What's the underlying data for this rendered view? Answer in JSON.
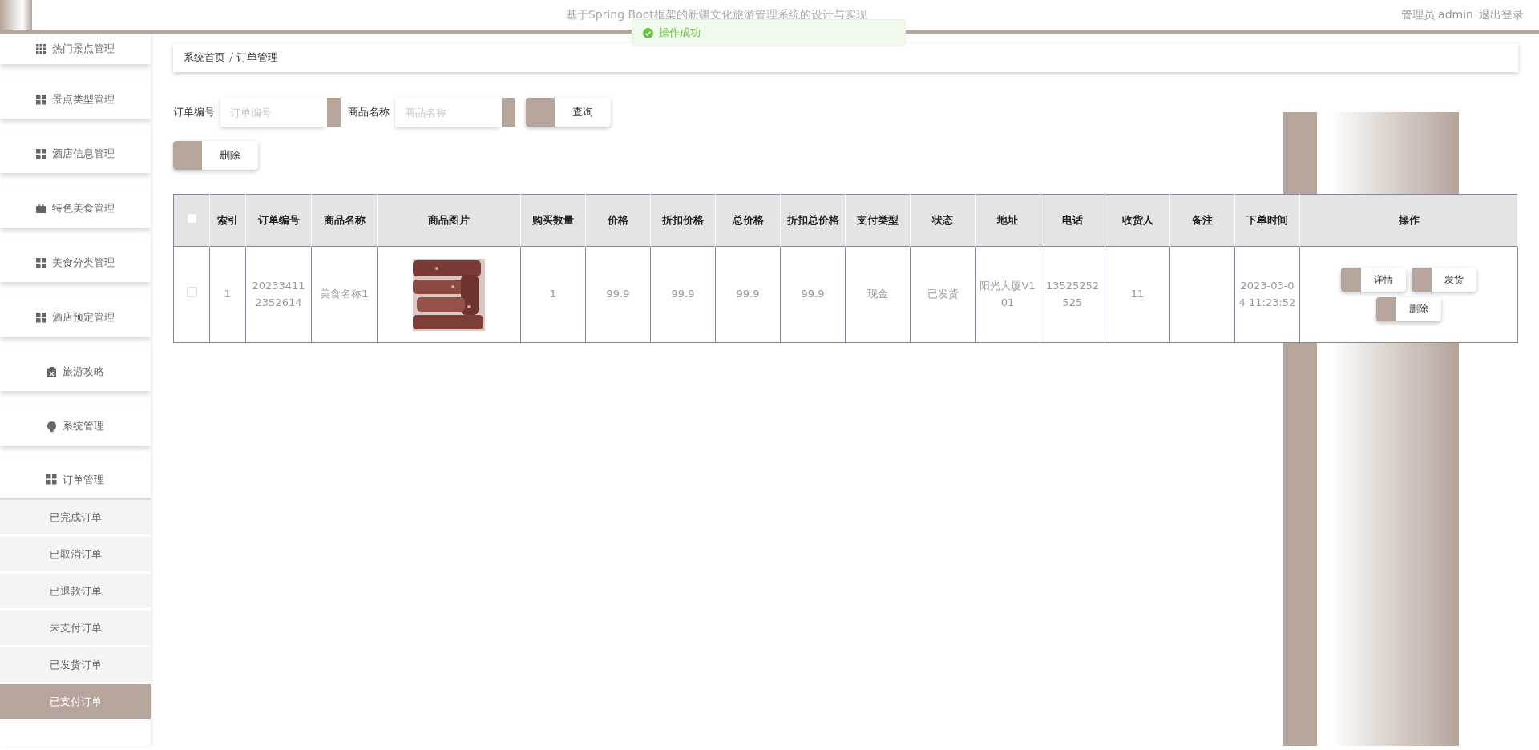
{
  "header": {
    "title": "基于Spring Boot框架的新疆文化旅游管理系统的设计与实现",
    "user": "管理员 admin",
    "logout": "退出登录"
  },
  "toast": {
    "message": "操作成功"
  },
  "sidebar": {
    "items": [
      {
        "label": "热门景点管理",
        "expanded": false
      },
      {
        "label": "景点类型管理",
        "expanded": false
      },
      {
        "label": "酒店信息管理",
        "expanded": false
      },
      {
        "label": "特色美食管理",
        "expanded": false
      },
      {
        "label": "美食分类管理",
        "expanded": false
      },
      {
        "label": "酒店预定管理",
        "expanded": false
      },
      {
        "label": "旅游攻略",
        "expanded": false
      },
      {
        "label": "系统管理",
        "expanded": false
      },
      {
        "label": "订单管理",
        "expanded": true,
        "children": [
          {
            "label": "已完成订单",
            "selected": false
          },
          {
            "label": "已取消订单",
            "selected": false
          },
          {
            "label": "已退款订单",
            "selected": false
          },
          {
            "label": "未支付订单",
            "selected": false
          },
          {
            "label": "已发货订单",
            "selected": false
          },
          {
            "label": "已支付订单",
            "selected": true
          }
        ]
      }
    ]
  },
  "breadcrumb": [
    "系统首页",
    "订单管理"
  ],
  "search": {
    "fields": [
      {
        "label": "订单编号",
        "placeholder": "订单编号"
      },
      {
        "label": "商品名称",
        "placeholder": "商品名称"
      }
    ],
    "button": "查询"
  },
  "toolbar": {
    "delete": "删除"
  },
  "table": {
    "select_all_checked": false,
    "columns": [
      "索引",
      "订单编号",
      "商品名称",
      "商品图片",
      "购买数量",
      "价格",
      "折扣价格",
      "总价格",
      "折扣总价格",
      "支付类型",
      "状态",
      "地址",
      "电话",
      "收货人",
      "备注",
      "下单时间",
      "操作"
    ],
    "rows": [
      {
        "checked": false,
        "cells": [
          "1",
          "202334112352614",
          "美食名称1",
          null,
          "1",
          "99.9",
          "99.9",
          "99.9",
          "99.9",
          "现金",
          "已发货",
          "阳光大厦V101",
          "13525252525",
          "11",
          "",
          "2023-03-04 11:23:52"
        ],
        "actions": [
          "详情",
          "发货",
          "删除"
        ]
      }
    ]
  }
}
